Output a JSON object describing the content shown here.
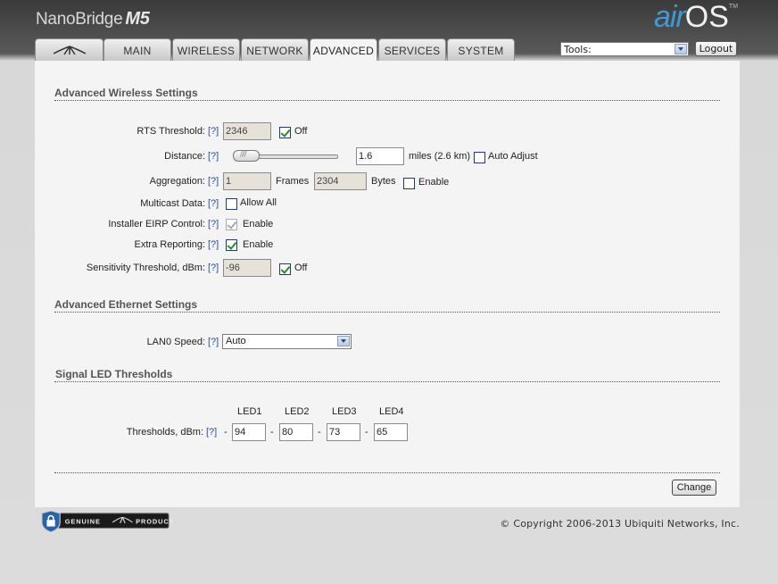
{
  "header": {
    "brand": "NanoBridge",
    "model": "M5",
    "logo_air": "air",
    "logo_os": "OS",
    "logo_tm": "TM"
  },
  "tabs": [
    {
      "label": "",
      "icon": "ubiquiti-logo-icon"
    },
    {
      "label": "MAIN"
    },
    {
      "label": "WIRELESS"
    },
    {
      "label": "NETWORK"
    },
    {
      "label": "ADVANCED",
      "active": true
    },
    {
      "label": "SERVICES"
    },
    {
      "label": "SYSTEM"
    }
  ],
  "tools": {
    "selected": "Tools:"
  },
  "logout_label": "Logout",
  "help": "[?]",
  "wireless": {
    "title": "Advanced Wireless Settings",
    "rts": {
      "label": "RTS Threshold:",
      "value": "2346",
      "off_label": "Off",
      "off_checked": true
    },
    "distance": {
      "label": "Distance:",
      "value": "1.6",
      "unit": "miles (2.6 km)",
      "auto_label": "Auto Adjust",
      "auto_checked": false
    },
    "aggregation": {
      "label": "Aggregation:",
      "frames_value": "1",
      "frames_label": "Frames",
      "bytes_value": "2304",
      "bytes_label": "Bytes",
      "enable_label": "Enable",
      "enable_checked": false
    },
    "multicast": {
      "label": "Multicast Data:",
      "allow_label": "Allow All",
      "checked": false
    },
    "eirp": {
      "label": "Installer EIRP Control:",
      "enable_label": "Enable",
      "checked": true
    },
    "extra": {
      "label": "Extra Reporting:",
      "enable_label": "Enable",
      "checked": true
    },
    "sensitivity": {
      "label": "Sensitivity Threshold, dBm:",
      "value": "-96",
      "off_label": "Off",
      "off_checked": true
    }
  },
  "ethernet": {
    "title": "Advanced Ethernet Settings",
    "lan0": {
      "label": "LAN0 Speed:",
      "value": "Auto"
    }
  },
  "led": {
    "title": "Signal LED Thresholds",
    "label": "Thresholds, dBm:",
    "headers": [
      "LED1",
      "LED2",
      "LED3",
      "LED4"
    ],
    "values": [
      "94",
      "80",
      "73",
      "65"
    ],
    "dash": "-"
  },
  "change_label": "Change",
  "footer": {
    "badge_left": "GENUINE",
    "badge_right": "PRODUCT",
    "copyright": "© Copyright 2006-2013 Ubiquiti Networks, Inc."
  },
  "colors": {
    "accent": "#3d9ad6",
    "link": "#2a4fa8",
    "check": "#2a8a2a"
  }
}
